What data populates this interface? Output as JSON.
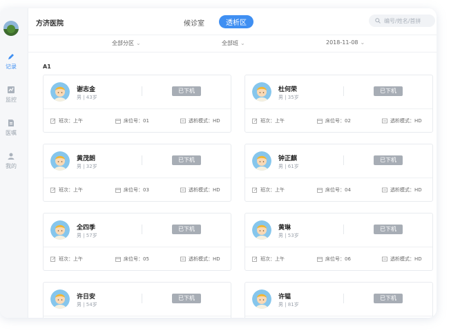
{
  "sidebar": {
    "items": [
      {
        "label": "记录",
        "icon": "pencil-icon",
        "active": true
      },
      {
        "label": "监控",
        "icon": "chart-icon",
        "active": false
      },
      {
        "label": "医嘱",
        "icon": "document-icon",
        "active": false
      },
      {
        "label": "我的",
        "icon": "person-icon",
        "active": false
      }
    ]
  },
  "header": {
    "hospital": "方济医院",
    "tabs": [
      {
        "label": "候诊室",
        "active": false
      },
      {
        "label": "透析区",
        "active": true
      }
    ],
    "search_placeholder": "编号/姓名/首拼"
  },
  "filters": [
    "全部分区",
    "全部班",
    "2018-11-08"
  ],
  "section": "A1",
  "accent_color": "#3f8ff2",
  "patients": [
    {
      "name": "谢志金",
      "info": "男 | 43岁",
      "status": "已下机",
      "shift": "班次：上午",
      "bed": "床位号：01",
      "mode": "透析模式：HD"
    },
    {
      "name": "杜何荣",
      "info": "男 | 35岁",
      "status": "已下机",
      "shift": "班次：上午",
      "bed": "床位号：02",
      "mode": "透析模式：HD"
    },
    {
      "name": "黄茂朗",
      "info": "男 | 32岁",
      "status": "已下机",
      "shift": "班次：上午",
      "bed": "床位号：03",
      "mode": "透析模式：HD"
    },
    {
      "name": "钟正麒",
      "info": "男 | 61岁",
      "status": "已下机",
      "shift": "班次：上午",
      "bed": "床位号：04",
      "mode": "透析模式：HD"
    },
    {
      "name": "全四季",
      "info": "男 | 57岁",
      "status": "已下机",
      "shift": "班次：上午",
      "bed": "床位号：05",
      "mode": "透析模式：HD"
    },
    {
      "name": "黄琳",
      "info": "男 | 53岁",
      "status": "已下机",
      "shift": "班次：上午",
      "bed": "床位号：06",
      "mode": "透析模式：HD"
    },
    {
      "name": "许日安",
      "info": "男 | 54岁",
      "status": "已下机"
    },
    {
      "name": "许韫",
      "info": "男 | 81岁",
      "status": "已下机"
    }
  ]
}
